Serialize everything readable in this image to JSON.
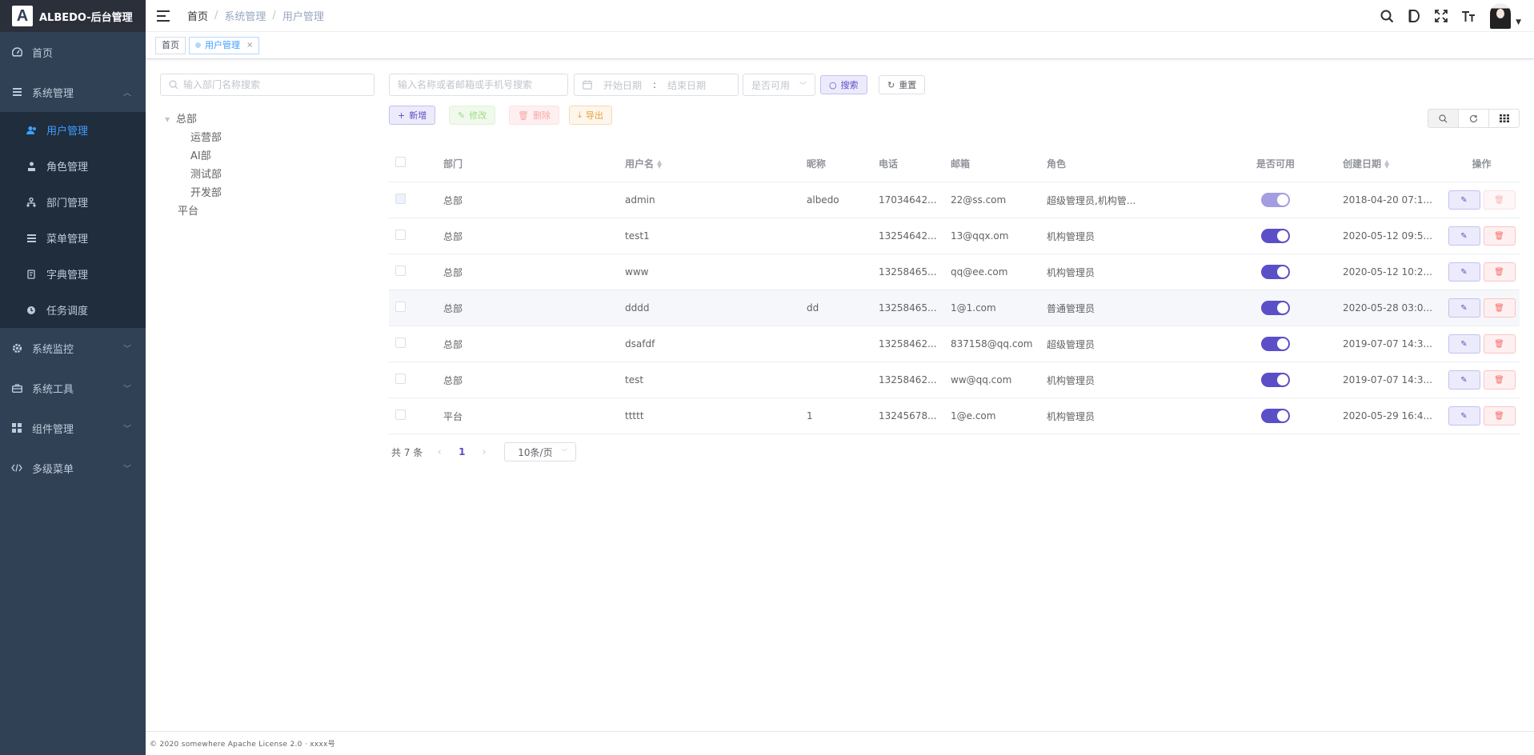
{
  "app": {
    "logo_letter": "A",
    "title": "ALBEDO-后台管理"
  },
  "sidebar": {
    "items": [
      {
        "label": "首页",
        "icon": "dashboard-icon"
      },
      {
        "label": "系统管理",
        "icon": "system-icon",
        "expanded": true
      },
      {
        "label": "系统监控",
        "icon": "monitor-icon"
      },
      {
        "label": "系统工具",
        "icon": "tool-icon"
      },
      {
        "label": "组件管理",
        "icon": "component-icon"
      },
      {
        "label": "多级菜单",
        "icon": "code-icon"
      }
    ],
    "submenu": [
      {
        "label": "用户管理",
        "icon": "user-icon",
        "active": true
      },
      {
        "label": "角色管理",
        "icon": "role-icon"
      },
      {
        "label": "部门管理",
        "icon": "dept-icon"
      },
      {
        "label": "菜单管理",
        "icon": "menu-icon"
      },
      {
        "label": "字典管理",
        "icon": "dict-icon"
      },
      {
        "label": "任务调度",
        "icon": "timer-icon"
      }
    ]
  },
  "header": {
    "breadcrumb": [
      "首页",
      "系统管理",
      "用户管理"
    ]
  },
  "tags": [
    {
      "label": "首页"
    },
    {
      "label": "用户管理",
      "close": "×"
    }
  ],
  "tree": {
    "search_placeholder": "输入部门名称搜索",
    "root": "总部",
    "children": [
      "运营部",
      "AI部",
      "测试部",
      "开发部"
    ],
    "root2": "平台"
  },
  "filters": {
    "keyword_placeholder": "输入名称或者邮箱或手机号搜索",
    "start_placeholder": "开始日期",
    "range_sep": ":",
    "end_placeholder": "结束日期",
    "enabled_placeholder": "是否可用",
    "search_label": "搜索",
    "reset_label": "重置"
  },
  "toolbar": {
    "add_label": "新增",
    "edit_label": "修改",
    "delete_label": "删除",
    "export_label": "导出"
  },
  "table": {
    "columns": [
      "部门",
      "用户名",
      "昵称",
      "电话",
      "邮箱",
      "角色",
      "是否可用",
      "创建日期",
      "操作"
    ],
    "rows": [
      {
        "dept": "总部",
        "user": "admin",
        "nick": "albedo",
        "phone": "17034642...",
        "mail": "22@ss.com",
        "role": "超级管理员,机构管...",
        "date": "2018-04-20 07:1...",
        "enabled": true
      },
      {
        "dept": "总部",
        "user": "test1",
        "nick": "",
        "phone": "13254642...",
        "mail": "13@qqx.om",
        "role": "机构管理员",
        "date": "2020-05-12 09:5...",
        "enabled": true
      },
      {
        "dept": "总部",
        "user": "www",
        "nick": "",
        "phone": "13258465...",
        "mail": "qq@ee.com",
        "role": "机构管理员",
        "date": "2020-05-12 10:2...",
        "enabled": true
      },
      {
        "dept": "总部",
        "user": "dddd",
        "nick": "dd",
        "phone": "13258465...",
        "mail": "1@1.com",
        "role": "普通管理员",
        "date": "2020-05-28 03:0...",
        "enabled": true
      },
      {
        "dept": "总部",
        "user": "dsafdf",
        "nick": "",
        "phone": "13258462...",
        "mail": "837158@qq.com",
        "role": "超级管理员",
        "date": "2019-07-07 14:3...",
        "enabled": true
      },
      {
        "dept": "总部",
        "user": "test",
        "nick": "",
        "phone": "13258462...",
        "mail": "ww@qq.com",
        "role": "机构管理员",
        "date": "2019-07-07 14:3...",
        "enabled": true
      },
      {
        "dept": "平台",
        "user": "ttttt",
        "nick": "1",
        "phone": "13245678...",
        "mail": "1@e.com",
        "role": "机构管理员",
        "date": "2020-05-29 16:4...",
        "enabled": true
      }
    ]
  },
  "pagination": {
    "total": "共 7 条",
    "prev": "‹",
    "page": "1",
    "next": "›",
    "size": "10条/页"
  },
  "footer": {
    "text": "© 2020 somewhere Apache License 2.0 · xxxx号"
  },
  "colors": {
    "sidebar_bg": "#304156",
    "accent": "#5b4fc7",
    "active_link": "#409eff"
  }
}
